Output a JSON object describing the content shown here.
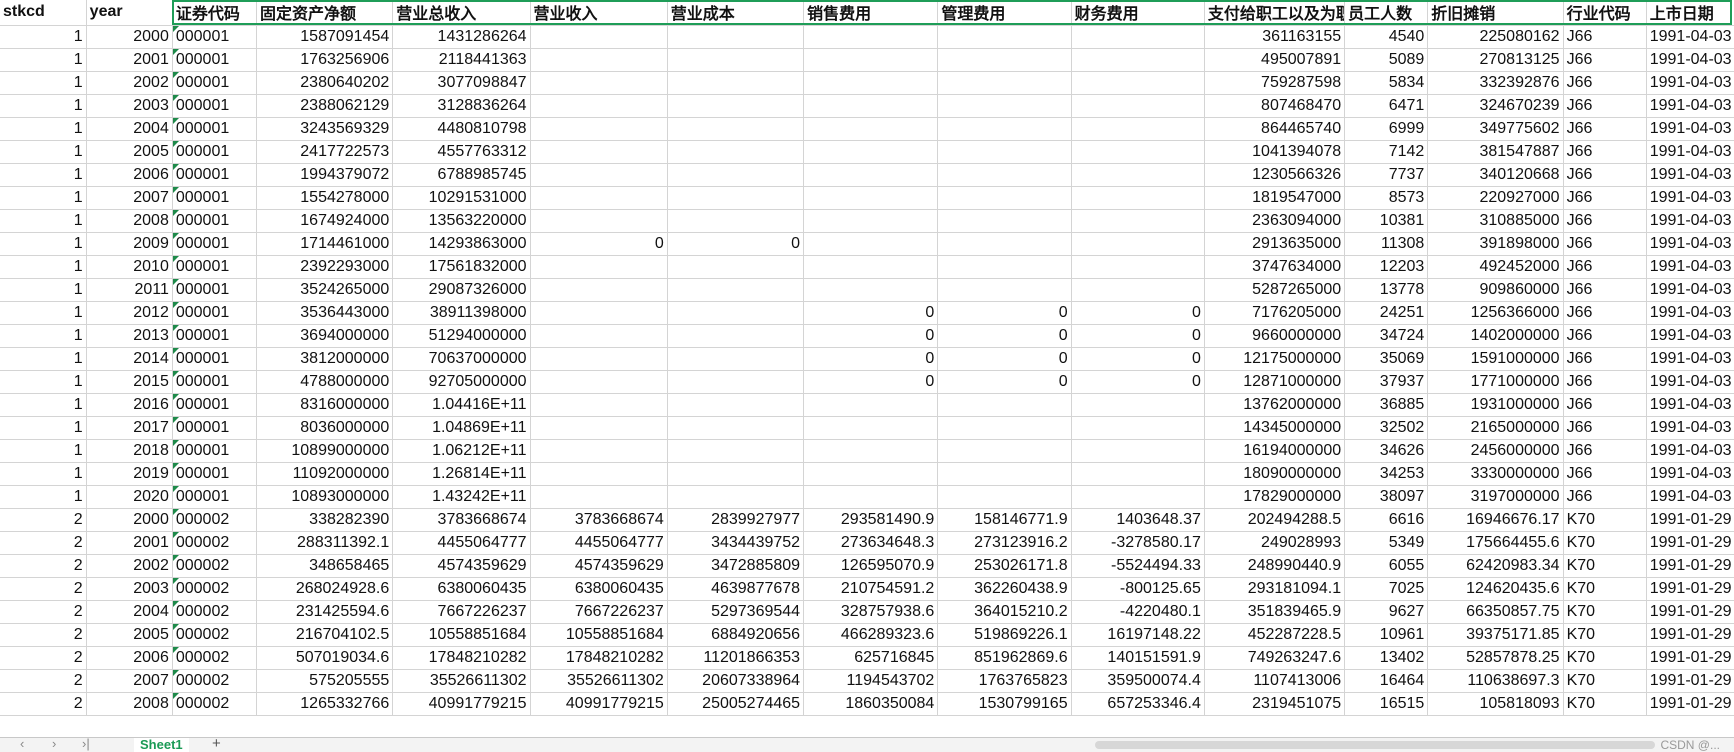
{
  "sheet": {
    "headers": [
      "stkcd",
      "year",
      "证券代码",
      "固定资产净额",
      "营业总收入",
      "营业收入",
      "营业成本",
      "销售费用",
      "管理费用",
      "财务费用",
      "支付给职工以及为职工支付的现金",
      "员工人数",
      "折旧摊销",
      "行业代码",
      "上市日期"
    ],
    "rows": [
      [
        "1",
        "2000",
        "000001",
        "1587091454",
        "1431286264",
        "",
        "",
        "",
        "",
        "",
        "361163155",
        "4540",
        "225080162",
        "J66",
        "1991-04-03"
      ],
      [
        "1",
        "2001",
        "000001",
        "1763256906",
        "2118441363",
        "",
        "",
        "",
        "",
        "",
        "495007891",
        "5089",
        "270813125",
        "J66",
        "1991-04-03"
      ],
      [
        "1",
        "2002",
        "000001",
        "2380640202",
        "3077098847",
        "",
        "",
        "",
        "",
        "",
        "759287598",
        "5834",
        "332392876",
        "J66",
        "1991-04-03"
      ],
      [
        "1",
        "2003",
        "000001",
        "2388062129",
        "3128836264",
        "",
        "",
        "",
        "",
        "",
        "807468470",
        "6471",
        "324670239",
        "J66",
        "1991-04-03"
      ],
      [
        "1",
        "2004",
        "000001",
        "3243569329",
        "4480810798",
        "",
        "",
        "",
        "",
        "",
        "864465740",
        "6999",
        "349775602",
        "J66",
        "1991-04-03"
      ],
      [
        "1",
        "2005",
        "000001",
        "2417722573",
        "4557763312",
        "",
        "",
        "",
        "",
        "",
        "1041394078",
        "7142",
        "381547887",
        "J66",
        "1991-04-03"
      ],
      [
        "1",
        "2006",
        "000001",
        "1994379072",
        "6788985745",
        "",
        "",
        "",
        "",
        "",
        "1230566326",
        "7737",
        "340120668",
        "J66",
        "1991-04-03"
      ],
      [
        "1",
        "2007",
        "000001",
        "1554278000",
        "10291531000",
        "",
        "",
        "",
        "",
        "",
        "1819547000",
        "8573",
        "220927000",
        "J66",
        "1991-04-03"
      ],
      [
        "1",
        "2008",
        "000001",
        "1674924000",
        "13563220000",
        "",
        "",
        "",
        "",
        "",
        "2363094000",
        "10381",
        "310885000",
        "J66",
        "1991-04-03"
      ],
      [
        "1",
        "2009",
        "000001",
        "1714461000",
        "14293863000",
        "0",
        "0",
        "",
        "",
        "",
        "2913635000",
        "11308",
        "391898000",
        "J66",
        "1991-04-03"
      ],
      [
        "1",
        "2010",
        "000001",
        "2392293000",
        "17561832000",
        "",
        "",
        "",
        "",
        "",
        "3747634000",
        "12203",
        "492452000",
        "J66",
        "1991-04-03"
      ],
      [
        "1",
        "2011",
        "000001",
        "3524265000",
        "29087326000",
        "",
        "",
        "",
        "",
        "",
        "5287265000",
        "13778",
        "909860000",
        "J66",
        "1991-04-03"
      ],
      [
        "1",
        "2012",
        "000001",
        "3536443000",
        "38911398000",
        "",
        "",
        "0",
        "0",
        "0",
        "7176205000",
        "24251",
        "1256366000",
        "J66",
        "1991-04-03"
      ],
      [
        "1",
        "2013",
        "000001",
        "3694000000",
        "51294000000",
        "",
        "",
        "0",
        "0",
        "0",
        "9660000000",
        "34724",
        "1402000000",
        "J66",
        "1991-04-03"
      ],
      [
        "1",
        "2014",
        "000001",
        "3812000000",
        "70637000000",
        "",
        "",
        "0",
        "0",
        "0",
        "12175000000",
        "35069",
        "1591000000",
        "J66",
        "1991-04-03"
      ],
      [
        "1",
        "2015",
        "000001",
        "4788000000",
        "92705000000",
        "",
        "",
        "0",
        "0",
        "0",
        "12871000000",
        "37937",
        "1771000000",
        "J66",
        "1991-04-03"
      ],
      [
        "1",
        "2016",
        "000001",
        "8316000000",
        "1.04416E+11",
        "",
        "",
        "",
        "",
        "",
        "13762000000",
        "36885",
        "1931000000",
        "J66",
        "1991-04-03"
      ],
      [
        "1",
        "2017",
        "000001",
        "8036000000",
        "1.04869E+11",
        "",
        "",
        "",
        "",
        "",
        "14345000000",
        "32502",
        "2165000000",
        "J66",
        "1991-04-03"
      ],
      [
        "1",
        "2018",
        "000001",
        "10899000000",
        "1.06212E+11",
        "",
        "",
        "",
        "",
        "",
        "16194000000",
        "34626",
        "2456000000",
        "J66",
        "1991-04-03"
      ],
      [
        "1",
        "2019",
        "000001",
        "11092000000",
        "1.26814E+11",
        "",
        "",
        "",
        "",
        "",
        "18090000000",
        "34253",
        "3330000000",
        "J66",
        "1991-04-03"
      ],
      [
        "1",
        "2020",
        "000001",
        "10893000000",
        "1.43242E+11",
        "",
        "",
        "",
        "",
        "",
        "17829000000",
        "38097",
        "3197000000",
        "J66",
        "1991-04-03"
      ],
      [
        "2",
        "2000",
        "000002",
        "338282390",
        "3783668674",
        "3783668674",
        "2839927977",
        "293581490.9",
        "158146771.9",
        "1403648.37",
        "202494288.5",
        "6616",
        "16946676.17",
        "K70",
        "1991-01-29"
      ],
      [
        "2",
        "2001",
        "000002",
        "288311392.1",
        "4455064777",
        "4455064777",
        "3434439752",
        "273634648.3",
        "273123916.2",
        "-3278580.17",
        "249028993",
        "5349",
        "175664455.6",
        "K70",
        "1991-01-29"
      ],
      [
        "2",
        "2002",
        "000002",
        "348658465",
        "4574359629",
        "4574359629",
        "3472885809",
        "126595070.9",
        "253026171.8",
        "-5524494.33",
        "248990440.9",
        "6055",
        "62420983.34",
        "K70",
        "1991-01-29"
      ],
      [
        "2",
        "2003",
        "000002",
        "268024928.6",
        "6380060435",
        "6380060435",
        "4639877678",
        "210754591.2",
        "362260438.9",
        "-800125.65",
        "293181094.1",
        "7025",
        "124620435.6",
        "K70",
        "1991-01-29"
      ],
      [
        "2",
        "2004",
        "000002",
        "231425594.6",
        "7667226237",
        "7667226237",
        "5297369544",
        "328757938.6",
        "364015210.2",
        "-4220480.1",
        "351839465.9",
        "9627",
        "66350857.75",
        "K70",
        "1991-01-29"
      ],
      [
        "2",
        "2005",
        "000002",
        "216704102.5",
        "10558851684",
        "10558851684",
        "6884920656",
        "466289323.6",
        "519869226.1",
        "16197148.22",
        "452287228.5",
        "10961",
        "39375171.85",
        "K70",
        "1991-01-29"
      ],
      [
        "2",
        "2006",
        "000002",
        "507019034.6",
        "17848210282",
        "17848210282",
        "11201866353",
        "625716845",
        "851962869.6",
        "140151591.9",
        "749263247.6",
        "13402",
        "52857878.25",
        "K70",
        "1991-01-29"
      ],
      [
        "2",
        "2007",
        "000002",
        "575205555",
        "35526611302",
        "35526611302",
        "20607338964",
        "1194543702",
        "1763765823",
        "359500074.4",
        "1107413006",
        "16464",
        "110638697.3",
        "K70",
        "1991-01-29"
      ],
      [
        "2",
        "2008",
        "000002",
        "1265332766",
        "40991779215",
        "40991779215",
        "25005274465",
        "1860350084",
        "1530799165",
        "657253346.4",
        "2319451075",
        "16515",
        "105818093",
        "K70",
        "1991-01-29"
      ]
    ]
  },
  "tabs": {
    "active": "Sheet1",
    "add": "+"
  },
  "nav": {
    "first": "|‹",
    "prev": "‹",
    "next": "›",
    "last": "›|"
  },
  "watermark": "CSDN @..."
}
